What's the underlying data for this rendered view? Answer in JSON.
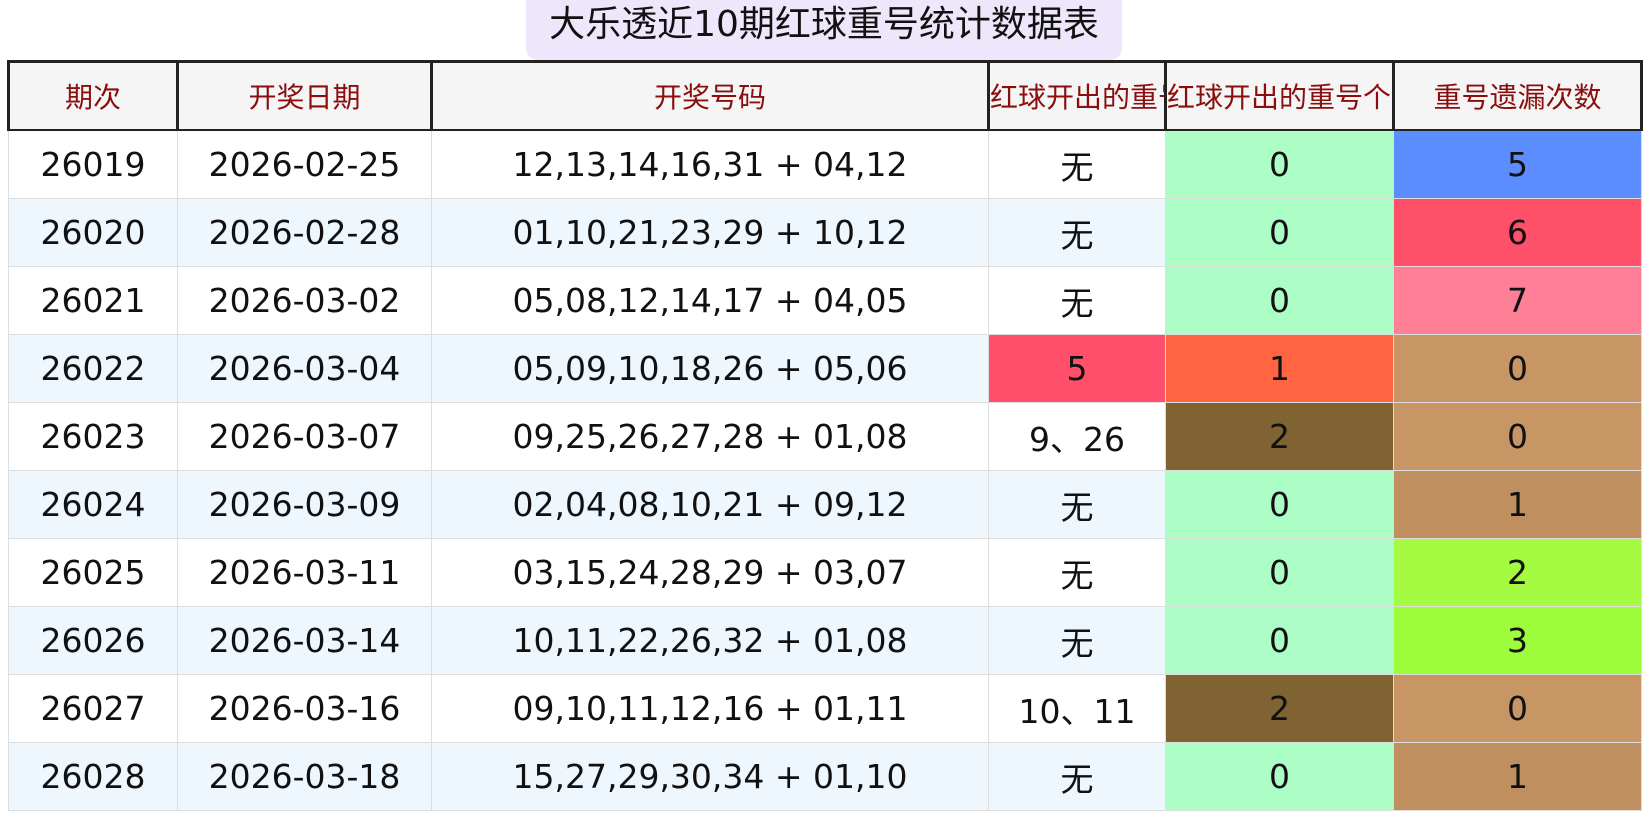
{
  "title": "大乐透近10期红球重号统计数据表",
  "headers": [
    "期次",
    "开奖日期",
    "开奖号码",
    "红球开出的重号",
    "红球开出的重号个数",
    "重号遗漏次数"
  ],
  "rows": [
    {
      "period": "26019",
      "date": "2026-02-25",
      "numbers": "12,13,14,16,31 + 04,12",
      "repeat": "无",
      "count": "0",
      "miss": "5"
    },
    {
      "period": "26020",
      "date": "2026-02-28",
      "numbers": "01,10,21,23,29 + 10,12",
      "repeat": "无",
      "count": "0",
      "miss": "6"
    },
    {
      "period": "26021",
      "date": "2026-03-02",
      "numbers": "05,08,12,14,17 + 04,05",
      "repeat": "无",
      "count": "0",
      "miss": "7"
    },
    {
      "period": "26022",
      "date": "2026-03-04",
      "numbers": "05,09,10,18,26 + 05,06",
      "repeat": "5",
      "count": "1",
      "miss": "0"
    },
    {
      "period": "26023",
      "date": "2026-03-07",
      "numbers": "09,25,26,27,28 + 01,08",
      "repeat": "9、26",
      "count": "2",
      "miss": "0"
    },
    {
      "period": "26024",
      "date": "2026-03-09",
      "numbers": "02,04,08,10,21 + 09,12",
      "repeat": "无",
      "count": "0",
      "miss": "1"
    },
    {
      "period": "26025",
      "date": "2026-03-11",
      "numbers": "03,15,24,28,29 + 03,07",
      "repeat": "无",
      "count": "0",
      "miss": "2"
    },
    {
      "period": "26026",
      "date": "2026-03-14",
      "numbers": "10,11,22,26,32 + 01,08",
      "repeat": "无",
      "count": "0",
      "miss": "3"
    },
    {
      "period": "26027",
      "date": "2026-03-16",
      "numbers": "09,10,11,12,16 + 01,11",
      "repeat": "10、11",
      "count": "2",
      "miss": "0"
    },
    {
      "period": "26028",
      "date": "2026-03-18",
      "numbers": "15,27,29,30,34 + 01,10",
      "repeat": "无",
      "count": "0",
      "miss": "1"
    }
  ],
  "colors": {
    "repeat": {
      "5": "#ff4f6a"
    },
    "count": {
      "0": "#adfdc6",
      "1": "#ff6540",
      "2": "#806333"
    },
    "miss": [
      "#5b8dff",
      "#ff5069",
      "#ff8096",
      "#c79664",
      "#c79664",
      "#c08f5f",
      "#a5fb41",
      "#9dfd3b",
      "#c79664",
      "#c08f5f"
    ]
  }
}
